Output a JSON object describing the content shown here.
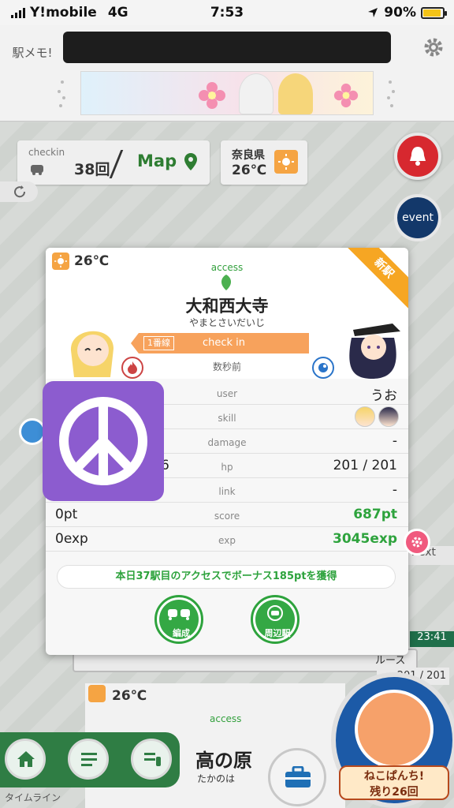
{
  "status_bar": {
    "carrier": "Y!mobile",
    "network": "4G",
    "time": "7:53",
    "battery": "90%",
    "battery_level": 0.9
  },
  "header": {
    "logo_text": "駅メモ!"
  },
  "map_panel": {
    "checkin_label": "checkin",
    "checkin_count": "38回",
    "map_label": "Map",
    "prefecture": "奈良県",
    "temperature": "26℃",
    "event_label": "event",
    "next_label": "next",
    "train_time": "23:41",
    "route_fragment": "ルース",
    "hp_fragment": "201 / 201"
  },
  "modal": {
    "temperature": "26℃",
    "new_badge": "新駅",
    "access_label": "access",
    "station_name": "大和西大寺",
    "station_reading": "やまとさいだいじ",
    "line_tag": "1番線",
    "checkin_label": "check in",
    "time_ago": "数秒前",
    "rows": [
      {
        "label": "user",
        "left": "",
        "right": "うお"
      },
      {
        "label": "skill",
        "left": "",
        "right": ""
      },
      {
        "label": "damage",
        "left": "",
        "right": "-"
      },
      {
        "label": "hp",
        "left": "6",
        "right": "201 / 201"
      },
      {
        "label": "link",
        "left": "",
        "right": "-"
      },
      {
        "label": "score",
        "left": "0pt",
        "right": "687pt"
      },
      {
        "label": "exp",
        "left": "0exp",
        "right": "3045exp"
      }
    ],
    "bonus_text": "本日37駅目のアクセスでボーナス185ptを獲得",
    "team_button": "編成",
    "nearby_button": "周辺駅"
  },
  "bottom": {
    "temperature": "26℃",
    "access_label": "access",
    "station_name": "高の原",
    "station_reading": "たかのは",
    "timeline_label": "タイムライン",
    "cat_label_line1": "ねこぱんち!",
    "cat_label_line2": "残り26回"
  },
  "colors": {
    "accent_green": "#2ea33d",
    "checkin_orange": "#f7a25c",
    "new_badge": "#f6a623",
    "peace_purple": "#8c5ccf"
  }
}
